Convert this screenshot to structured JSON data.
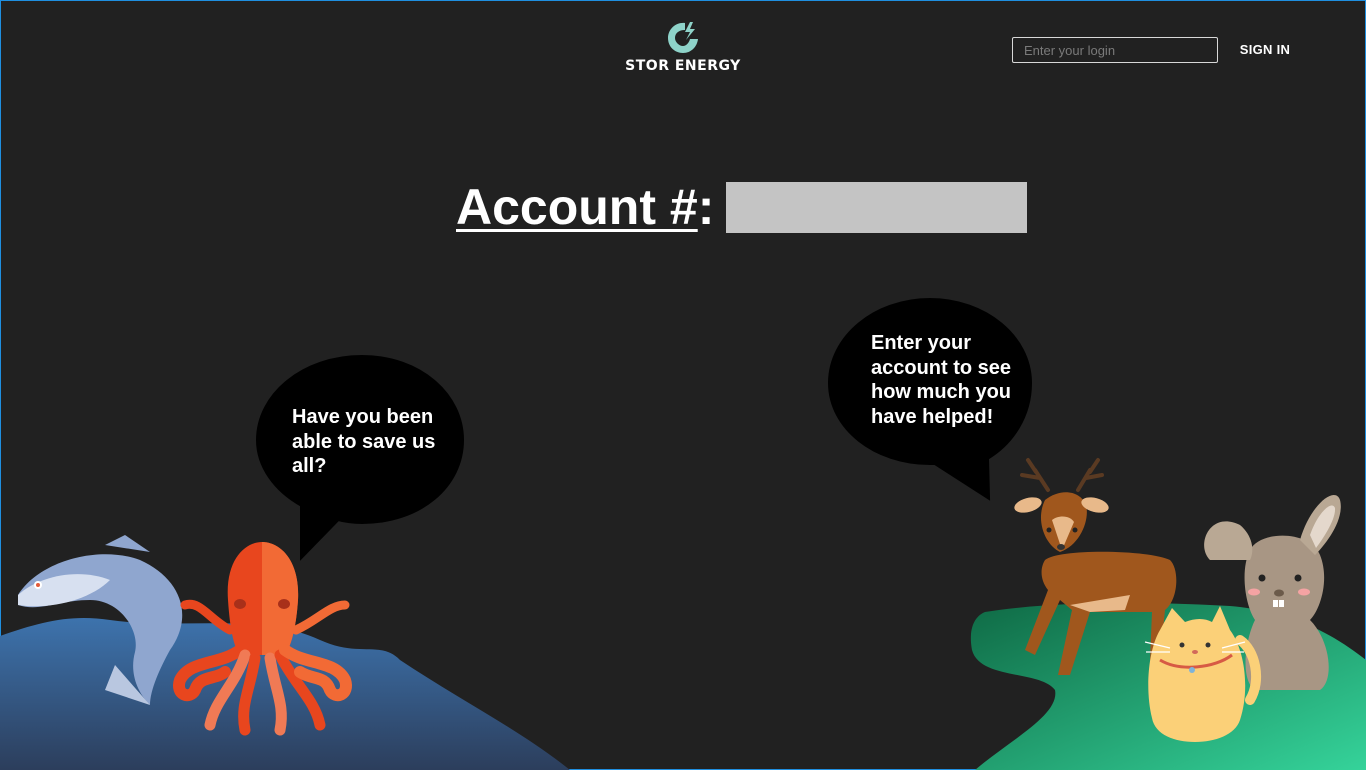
{
  "brand": {
    "name": "STOR ENERGY",
    "logo_icon": "power-leaf-logo",
    "accent": "#8ed3c9"
  },
  "header": {
    "login": {
      "placeholder": "Enter your login",
      "value": ""
    },
    "signin_label": "SIGN IN"
  },
  "account": {
    "title": "Account #",
    "colon": ":",
    "value": ""
  },
  "bubbles": {
    "octopus": "Have you been\nable to save us\nall?",
    "deer": "Enter your\naccount to see\nhow much you\nhave helped!"
  },
  "colors": {
    "background": "#212121",
    "ocean": "#3b6ea5",
    "grass": "#1f8c5c",
    "account_field": "#c4c4c4"
  }
}
